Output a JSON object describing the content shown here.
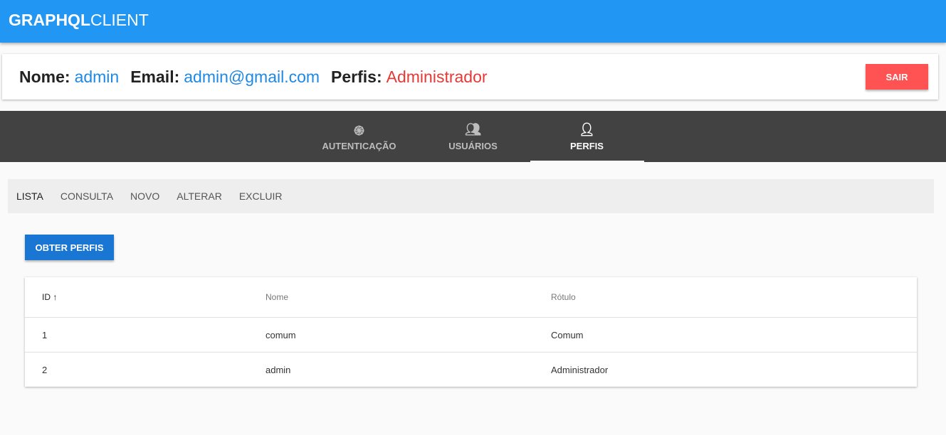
{
  "app": {
    "title_bold": "GRAPHQL",
    "title_light": "CLIENT"
  },
  "user": {
    "nome_label": "Nome:",
    "nome": "admin",
    "email_label": "Email:",
    "email": "admin@gmail.com",
    "perfis_label": "Perfis:",
    "perfis": "Administrador",
    "logout": "SAIR"
  },
  "tabs": [
    {
      "label": "AUTENTICAÇÃO",
      "icon": "fingerprint-icon"
    },
    {
      "label": "USUÁRIOS",
      "icon": "people-icon"
    },
    {
      "label": "PERFIS",
      "icon": "person-check-icon",
      "active": true
    }
  ],
  "subtabs": [
    "LISTA",
    "CONSULTA",
    "NOVO",
    "ALTERAR",
    "EXCLUIR"
  ],
  "action": "OBTER PERFIS",
  "table": {
    "headers": [
      "ID",
      "Nome",
      "Rótulo"
    ],
    "sort_icon": "↑",
    "rows": [
      [
        "1",
        "comum",
        "Comum"
      ],
      [
        "2",
        "admin",
        "Administrador"
      ]
    ]
  }
}
